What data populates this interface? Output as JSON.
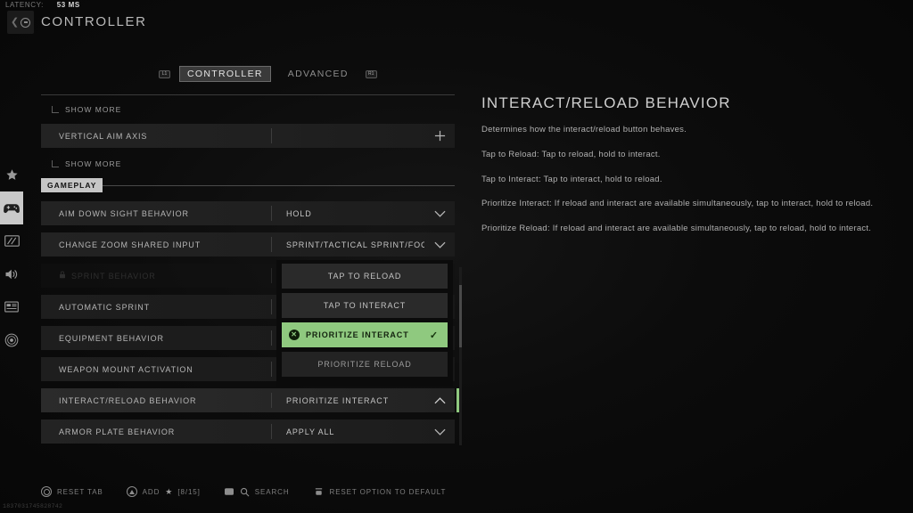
{
  "header": {
    "latency_label": "LATENCY:",
    "latency_value": "53 MS",
    "back_icon": "back-circle-button-icon",
    "title": "CONTROLLER"
  },
  "accent_colors": {
    "highlight_green": "#8fc97f",
    "selected_chip": "#c6c6c6",
    "text_primary": "#c4c4c4",
    "text_dim": "#7e7e7e"
  },
  "sidebar": {
    "items": [
      {
        "name": "favorites",
        "icon": "star-icon",
        "active": false
      },
      {
        "name": "controller",
        "icon": "gamepad-icon",
        "active": true
      },
      {
        "name": "graphics",
        "icon": "display-icon",
        "active": false
      },
      {
        "name": "audio",
        "icon": "speaker-icon",
        "active": false
      },
      {
        "name": "interface",
        "icon": "interface-icon",
        "active": false
      },
      {
        "name": "accessibility",
        "icon": "accessibility-icon",
        "active": false
      }
    ]
  },
  "tabs": {
    "left_bumper": "L1",
    "right_bumper": "R1",
    "items": [
      {
        "label": "CONTROLLER",
        "active": true
      },
      {
        "label": "ADVANCED",
        "active": false
      }
    ]
  },
  "settings": {
    "show_more_1": "SHOW MORE",
    "show_more_2": "SHOW MORE",
    "section_gameplay": "GAMEPLAY",
    "rows": [
      {
        "label": "VERTICAL AIM AXIS",
        "value": "",
        "control": "plus-icon"
      },
      {
        "label": "AIM DOWN SIGHT BEHAVIOR",
        "value": "HOLD",
        "control": "chevron-down-icon"
      },
      {
        "label": "CHANGE ZOOM SHARED INPUT",
        "value": "SPRINT/TACTICAL SPRINT/FOCUS",
        "control": "chevron-down-icon"
      },
      {
        "label": "SPRINT BEHAVIOR",
        "value": "",
        "control": "lock-icon",
        "disabled": true
      },
      {
        "label": "AUTOMATIC SPRINT",
        "value": "",
        "control": "chevron-down-icon"
      },
      {
        "label": "EQUIPMENT BEHAVIOR",
        "value": "",
        "control": "chevron-down-icon"
      },
      {
        "label": "WEAPON MOUNT ACTIVATION",
        "value": "",
        "control": "chevron-down-icon"
      },
      {
        "label": "INTERACT/RELOAD BEHAVIOR",
        "value": "PRIORITIZE INTERACT",
        "control": "chevron-up-icon",
        "selected": true
      },
      {
        "label": "ARMOR PLATE BEHAVIOR",
        "value": "APPLY ALL",
        "control": "chevron-down-icon"
      }
    ]
  },
  "dropdown": {
    "open_for": "INTERACT/RELOAD BEHAVIOR",
    "options": [
      {
        "label": "TAP TO RELOAD",
        "selected": false
      },
      {
        "label": "TAP TO INTERACT",
        "selected": false
      },
      {
        "label": "PRIORITIZE INTERACT",
        "selected": true,
        "badge_icon": "x-button-icon",
        "check_icon": "check-icon"
      },
      {
        "label": "PRIORITIZE RELOAD",
        "selected": false
      }
    ]
  },
  "info_panel": {
    "title": "INTERACT/RELOAD BEHAVIOR",
    "paragraphs": [
      "Determines how the interact/reload button behaves.",
      "Tap to Reload: Tap to reload, hold to interact.",
      "Tap to Interact: Tap to interact, hold to reload.",
      "Prioritize Interact: If reload and interact are available simultaneously, tap to interact, hold to reload.",
      "Prioritize Reload: If reload and interact are available simultaneously, tap to reload, hold to interact."
    ]
  },
  "bottom_bar": {
    "reset_tab": "RESET TAB",
    "add": "ADD",
    "add_count": "[8/15]",
    "search": "SEARCH",
    "reset_option": "RESET OPTION TO DEFAULT"
  },
  "watermark": "1837031745828742"
}
